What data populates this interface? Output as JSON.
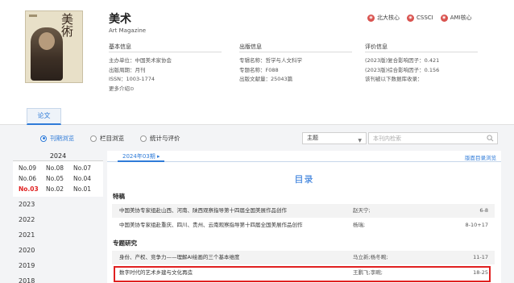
{
  "journal": {
    "cover_title": "美\n術",
    "title": "美术",
    "english_title": "Art Magazine",
    "badges": [
      {
        "label": "北大核心",
        "icon": "peking-core-icon"
      },
      {
        "label": "CSSCI",
        "icon": "cssci-icon"
      },
      {
        "label": "AMI核心",
        "icon": "ami-core-icon"
      }
    ]
  },
  "info": {
    "basic": {
      "heading": "基本信息",
      "rows": [
        "主办单位：中国美术家协会",
        "出版周期：月刊",
        "ISSN：1003-1774"
      ],
      "more": "更多介绍⊙"
    },
    "publish": {
      "heading": "出版信息",
      "rows": [
        "专辑名称：哲学与人文科学",
        "专题名称：F088",
        "出版文献量：25043篇"
      ]
    },
    "evaluation": {
      "heading": "评价信息",
      "rows": [
        "(2023版)复合影响因子：0.421",
        "(2023版)综合影响因子：0.156",
        "该刊被以下数据库收录："
      ]
    }
  },
  "tabs": {
    "papers": "论文"
  },
  "filters": {
    "radios": [
      {
        "label": "刊期浏览",
        "selected": true
      },
      {
        "label": "栏目浏览",
        "selected": false
      },
      {
        "label": "统计与评价",
        "selected": false
      }
    ],
    "select_value": "主题",
    "search_placeholder": "本刊内检索"
  },
  "sidebar": {
    "current_year": "2024",
    "issues": [
      {
        "label": "No.09",
        "active": false
      },
      {
        "label": "No.08",
        "active": false
      },
      {
        "label": "No.07",
        "active": false
      },
      {
        "label": "No.06",
        "active": false
      },
      {
        "label": "No.05",
        "active": false
      },
      {
        "label": "No.04",
        "active": false
      },
      {
        "label": "No.03",
        "active": true
      },
      {
        "label": "No.02",
        "active": false
      },
      {
        "label": "No.01",
        "active": false
      }
    ],
    "years": [
      "2023",
      "2022",
      "2021",
      "2020",
      "2019",
      "2018"
    ]
  },
  "content": {
    "issue_tab": "2024年03期",
    "toc_link": "版面目录浏览",
    "toc_title": "目录",
    "sections": [
      {
        "name": "特稿",
        "articles": [
          {
            "title": "中国美协专家组赴山西、河南、陕西观察指导第十四届全国美展作品创作",
            "author": "赵天宁;",
            "pages": "6-8"
          },
          {
            "title": "中国美协专家组赴重庆、四川、贵州、云南观察指导第十四届全国美展作品创作",
            "author": "杨瑞;",
            "pages": "8-10+17"
          }
        ]
      },
      {
        "name": "专题研究",
        "articles": [
          {
            "title": "身份、产权、竞争力——理解AI绘画的三个基本维度",
            "author": "马立新;杨冬畹;",
            "pages": "11-17"
          },
          {
            "title": "数字时代的艺术乡建与文化再造",
            "author": "王鹏飞;李畹;",
            "pages": "18-25"
          }
        ]
      }
    ]
  }
}
